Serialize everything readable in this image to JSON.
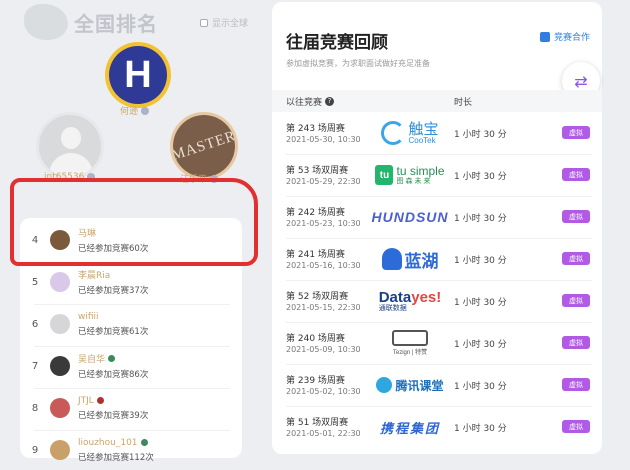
{
  "ranking": {
    "title": "全国排名",
    "global_toggle_label": "显示全球",
    "podium": [
      {
        "name": "何逊",
        "avatar_letter": "H"
      },
      {
        "name": "int65536",
        "avatar_letter": ""
      },
      {
        "name": "汪乐平",
        "avatar_text": "MASTER"
      }
    ],
    "list": [
      {
        "rank": "4",
        "name": "马琳",
        "subtitle": "已经参加竞赛60次",
        "avatar_color": "#7a5a3a",
        "dot_color": ""
      },
      {
        "rank": "5",
        "name": "李晨Ria",
        "subtitle": "已经参加竞赛37次",
        "avatar_color": "#d9c8e8",
        "dot_color": ""
      },
      {
        "rank": "6",
        "name": "wifiii",
        "subtitle": "已经参加竞赛61次",
        "avatar_color": "#d6d6d8",
        "dot_color": ""
      },
      {
        "rank": "7",
        "name": "吴自华",
        "subtitle": "已经参加竞赛86次",
        "avatar_color": "#3a3a3a",
        "dot_color": "#3a8a5a"
      },
      {
        "rank": "8",
        "name": "JTJL",
        "subtitle": "已经参加竞赛39次",
        "avatar_color": "#c85a5a",
        "dot_color": "#b03030"
      },
      {
        "rank": "9",
        "name": "liouzhou_101",
        "subtitle": "已经参加竞赛112次",
        "avatar_color": "#caa06a",
        "dot_color": "#3a8a5a"
      }
    ]
  },
  "contests": {
    "title": "往届竞赛回顾",
    "subtitle": "参加虚拟竞赛，为求职面试做好充足准备",
    "coop_label": "竞赛合作",
    "col_contest": "以往竞赛",
    "col_duration": "时长",
    "badge_label": "虚拟",
    "rows": [
      {
        "name": "第 243 场周赛",
        "date": "2021-05-30, 10:30",
        "duration": "1 小时 30 分",
        "sponsor": "CooTek 触宝"
      },
      {
        "name": "第 53 场双周赛",
        "date": "2021-05-29, 22:30",
        "duration": "1 小时 30 分",
        "sponsor": "tusimple 图森未来"
      },
      {
        "name": "第 242 场周赛",
        "date": "2021-05-23, 10:30",
        "duration": "1 小时 30 分",
        "sponsor": "HUNDSUN"
      },
      {
        "name": "第 241 场周赛",
        "date": "2021-05-16, 10:30",
        "duration": "1 小时 30 分",
        "sponsor": "蓝湖"
      },
      {
        "name": "第 52 场双周赛",
        "date": "2021-05-15, 22:30",
        "duration": "1 小时 30 分",
        "sponsor": "Datayes! 通联数据"
      },
      {
        "name": "第 240 场周赛",
        "date": "2021-05-09, 10:30",
        "duration": "1 小时 30 分",
        "sponsor": "Tezign 特赞"
      },
      {
        "name": "第 239 场周赛",
        "date": "2021-05-02, 10:30",
        "duration": "1 小时 30 分",
        "sponsor": "腾讯课堂"
      },
      {
        "name": "第 51 场双周赛",
        "date": "2021-05-01, 22:30",
        "duration": "1 小时 30 分",
        "sponsor": "携程集团"
      }
    ]
  },
  "logos": {
    "cootek_cn": "触宝",
    "cootek_en": "CooTek",
    "tusimple_en": "tu simple",
    "tusimple_cn": "图森未来",
    "hundsun": "HUNDSUN",
    "lanhu": "蓝湖",
    "datayes_a": "Data",
    "datayes_b": "yes!",
    "datayes_cn": "通联数据",
    "tezign": "Tezign | 特赞",
    "tencent": "腾讯课堂",
    "ctrip": "携程集团"
  },
  "colors": {
    "accent_purple": "#b15ae6",
    "link_blue": "#2f7ee0",
    "gold_name": "#c9a66b",
    "highlight_red": "#e23030"
  }
}
